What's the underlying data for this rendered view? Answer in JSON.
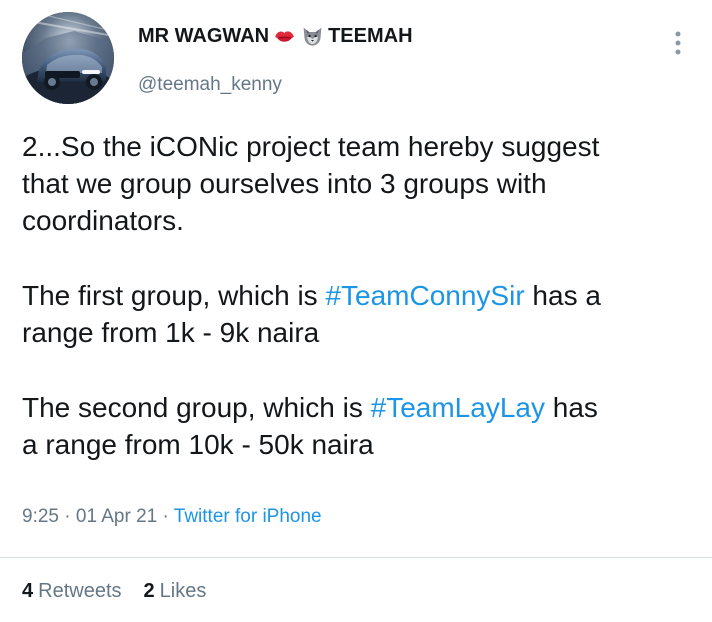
{
  "profile": {
    "display_name_part_1": "MR WAGWAN",
    "display_name_part_2": "TEEMAH",
    "username": "@teemah_kenny",
    "emoji_1": "kiss-mark-icon",
    "emoji_2": "wolf-face-icon",
    "avatar": "avatar-photo"
  },
  "tweet": {
    "lines": [
      "2...So the iCONic project team hereby suggest",
      "that we group ourselves into 3 groups with",
      "coordinators."
    ],
    "paragraph_2": {
      "prefix": "The first group, which is ",
      "hashtag": "#TeamConnySir",
      "suffix": " has a",
      "line_2": "range from 1k - 9k naira"
    },
    "paragraph_3": {
      "prefix": "The second group, which is ",
      "hashtag": "#TeamLayLay",
      "suffix": " has",
      "line_2": "a range from 10k - 50k naira"
    }
  },
  "meta": {
    "time": "9:25",
    "separator_1": " · ",
    "date": "01 Apr 21",
    "separator_2": " · ",
    "source": "Twitter for iPhone"
  },
  "stats": {
    "retweets_count": "4",
    "retweets_label": "Retweets",
    "likes_count": "2",
    "likes_label": "Likes"
  },
  "colors": {
    "link": "#1d95e6",
    "secondary_text": "#657786",
    "primary_text": "#14171a",
    "divider": "#d9e1e8"
  },
  "icons": {
    "more": "more-vertical-icon"
  }
}
